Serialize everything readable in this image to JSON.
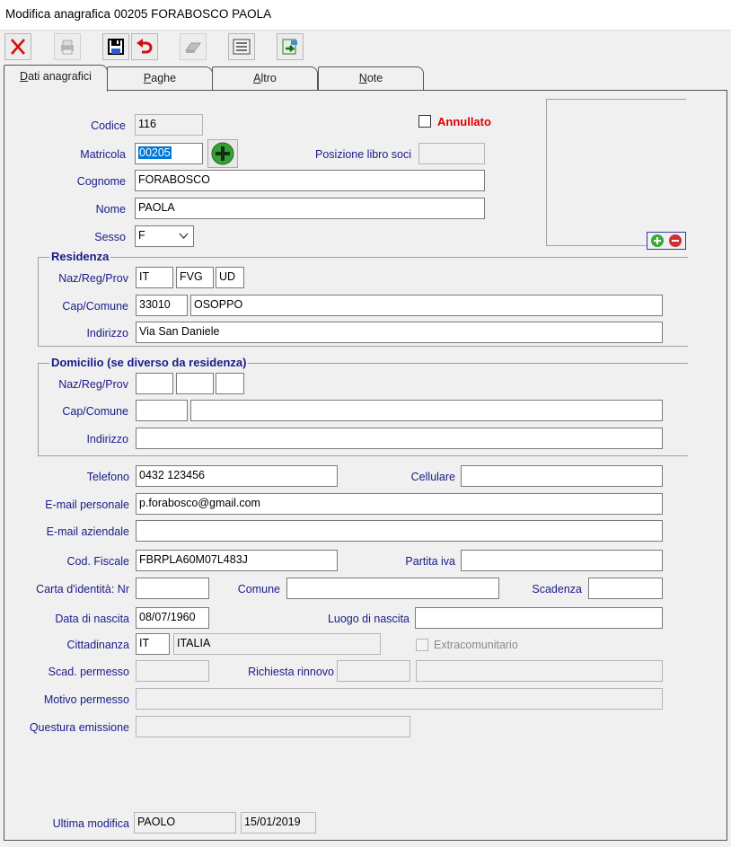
{
  "window": {
    "title": "Modifica anagrafica 00205 FORABOSCO PAOLA"
  },
  "toolbar": {
    "icons": [
      "close-icon",
      "print-icon",
      "save-icon",
      "undo-icon",
      "eraser-icon",
      "list-icon",
      "export-icon"
    ]
  },
  "tabs": [
    {
      "label": "Dati anagrafici",
      "active": true
    },
    {
      "label": "Paghe"
    },
    {
      "label": "Altro"
    },
    {
      "label": "Note"
    }
  ],
  "form": {
    "codice": {
      "label": "Codice",
      "value": "116"
    },
    "annullato": {
      "label": "Annullato",
      "checked": false
    },
    "matricola": {
      "label": "Matricola",
      "value": "00205"
    },
    "posizione": {
      "label": "Posizione libro soci",
      "value": ""
    },
    "cognome": {
      "label": "Cognome",
      "value": "FORABOSCO"
    },
    "nome": {
      "label": "Nome",
      "value": "PAOLA"
    },
    "sesso": {
      "label": "Sesso",
      "value": "F"
    },
    "residenza": {
      "title": "Residenza",
      "naz_label": "Naz/Reg/Prov",
      "naz": "IT",
      "reg": "FVG",
      "prov": "UD",
      "cap_label": "Cap/Comune",
      "cap": "33010",
      "comune": "OSOPPO",
      "ind_label": "Indirizzo",
      "indirizzo": "Via San Daniele"
    },
    "domicilio": {
      "title": "Domicilio (se diverso da residenza)",
      "naz_label": "Naz/Reg/Prov",
      "naz": "",
      "reg": "",
      "prov": "",
      "cap_label": "Cap/Comune",
      "cap": "",
      "comune": "",
      "ind_label": "Indirizzo",
      "indirizzo": ""
    },
    "telefono": {
      "label": "Telefono",
      "value": "0432 123456"
    },
    "cellulare": {
      "label": "Cellulare",
      "value": ""
    },
    "email_pers": {
      "label": "E-mail personale",
      "value": "p.forabosco@gmail.com"
    },
    "email_az": {
      "label": "E-mail aziendale",
      "value": ""
    },
    "cod_fiscale": {
      "label": "Cod. Fiscale",
      "value": "FBRPLA60M07L483J"
    },
    "partita_iva": {
      "label": "Partita iva",
      "value": ""
    },
    "carta_id": {
      "label": "Carta d'identità: Nr",
      "value": ""
    },
    "comune_ci": {
      "label": "Comune",
      "value": ""
    },
    "scadenza": {
      "label": "Scadenza",
      "value": ""
    },
    "data_nascita": {
      "label": "Data di nascita",
      "value": "08/07/1960"
    },
    "luogo_nascita": {
      "label": "Luogo di nascita",
      "value": ""
    },
    "cittadinanza": {
      "label": "Cittadinanza",
      "code": "IT",
      "name": "ITALIA"
    },
    "extracom": {
      "label": "Extracomunitario",
      "checked": false
    },
    "scad_permesso": {
      "label": "Scad. permesso",
      "value": ""
    },
    "richiesta_rinnovo": {
      "label": "Richiesta rinnovo",
      "value": "",
      "value2": ""
    },
    "motivo_permesso": {
      "label": "Motivo permesso",
      "value": ""
    },
    "questura": {
      "label": "Questura emissione",
      "value": ""
    },
    "ultima_modifica": {
      "label": "Ultima modifica",
      "user": "PAOLO",
      "date": "15/01/2019"
    }
  }
}
